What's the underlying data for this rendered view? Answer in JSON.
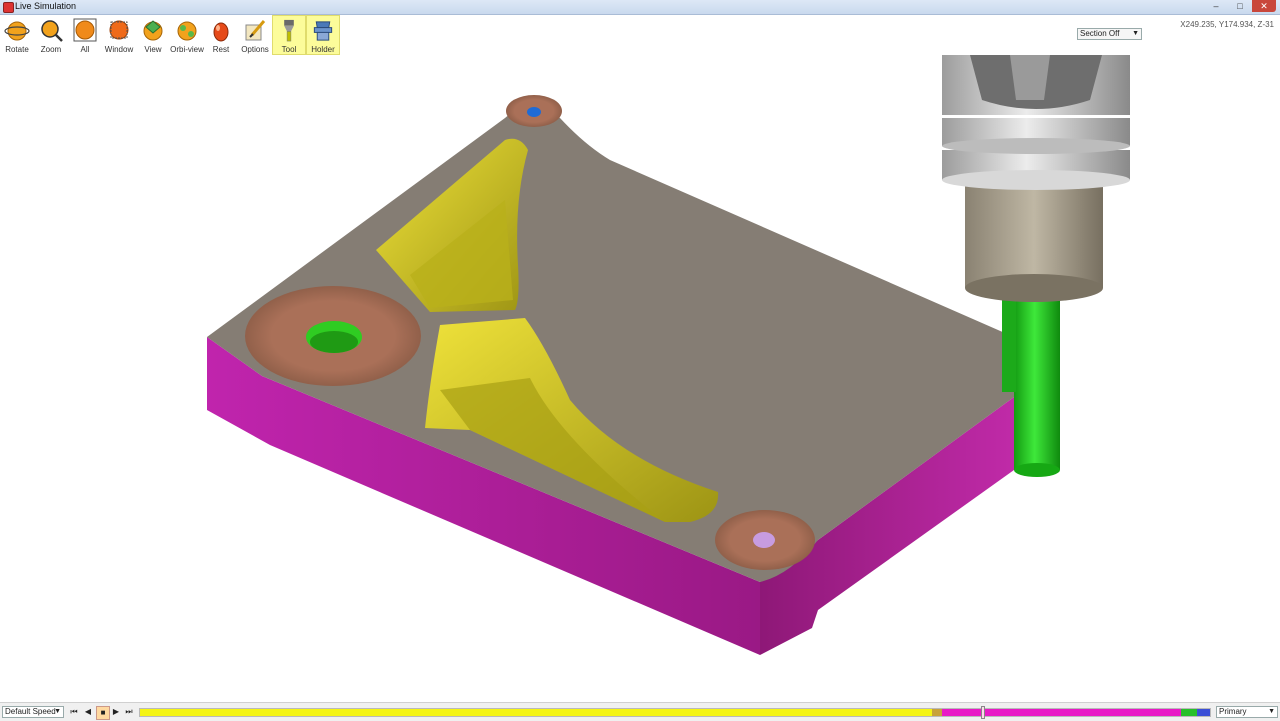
{
  "window": {
    "title": "Live Simulation"
  },
  "toolbar": {
    "items": [
      {
        "label": "Rotate",
        "icon": "rotate-icon",
        "active": false
      },
      {
        "label": "Zoom",
        "icon": "zoom-icon",
        "active": false
      },
      {
        "label": "All",
        "icon": "fit-all-icon",
        "active": false
      },
      {
        "label": "Window",
        "icon": "zoom-window-icon",
        "active": false
      },
      {
        "label": "View",
        "icon": "view-icon",
        "active": false
      },
      {
        "label": "Orbi-view",
        "icon": "orbi-view-icon",
        "active": false
      },
      {
        "label": "Rest",
        "icon": "rest-material-icon",
        "active": false
      },
      {
        "label": "Options",
        "icon": "options-icon",
        "active": false
      },
      {
        "label": "Tool",
        "icon": "tool-icon",
        "active": true
      },
      {
        "label": "Holder",
        "icon": "holder-icon",
        "active": true
      }
    ]
  },
  "section": {
    "value": "Section Off"
  },
  "coords": {
    "text": "X249.235, Y174.934, Z-31"
  },
  "playback": {
    "speed": "Default Speed",
    "mode": "Primary",
    "progress": 0.787,
    "segments": [
      {
        "color": "#f4f414",
        "fraction": 0.74
      },
      {
        "color": "#c7a23a",
        "fraction": 0.01
      },
      {
        "color": "#e81ac6",
        "fraction": 0.223
      },
      {
        "color": "#27c02a",
        "fraction": 0.015
      },
      {
        "color": "#3b4fd6",
        "fraction": 0.012
      }
    ]
  },
  "colors": {
    "stock_side": "#a3198f",
    "stock_top": "#8a837b",
    "pocket": "#c9c018",
    "boss": "#a26a52",
    "tool": "#22c41e",
    "holder": "#c9c9c9"
  }
}
